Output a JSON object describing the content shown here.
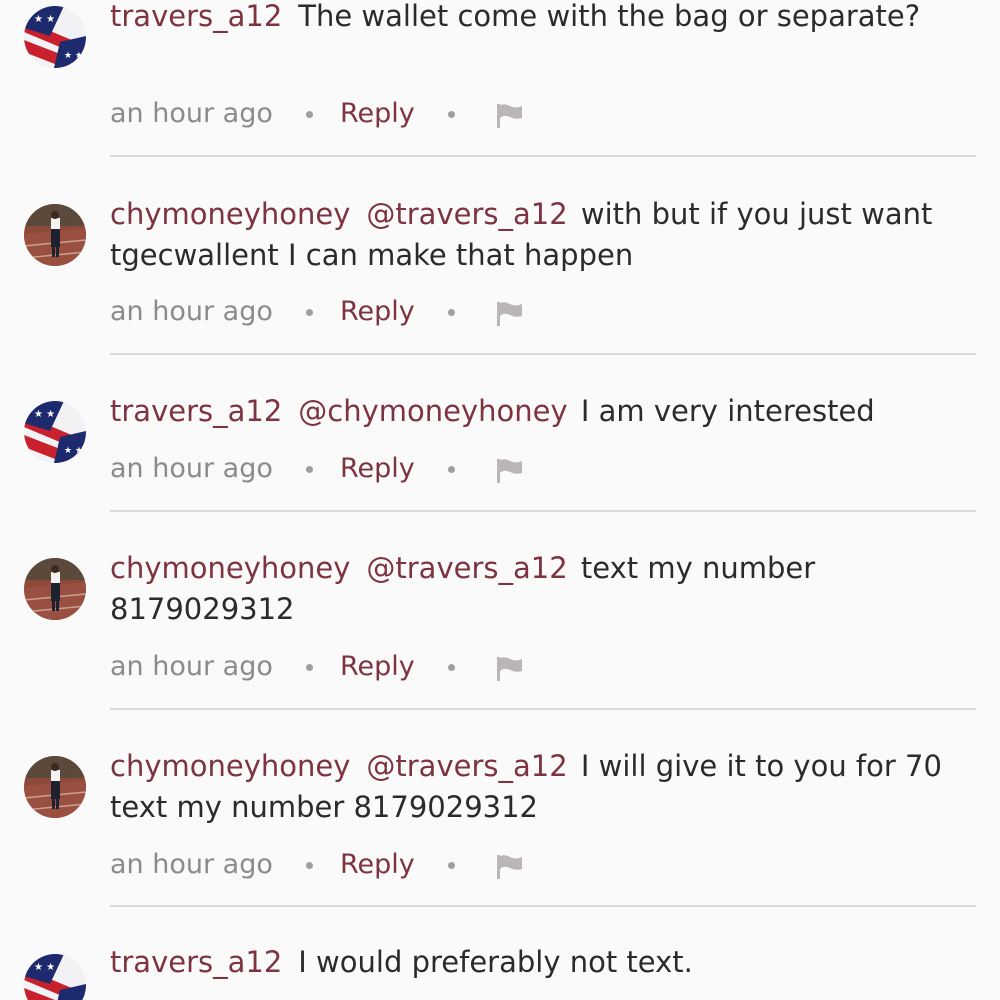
{
  "comments": [
    {
      "username": "travers_a12",
      "avatar_icon": "flag-avatar-icon",
      "mention": "",
      "text": "The wallet come with the bag or separate?",
      "time": "an hour ago",
      "reply_label": "Reply"
    },
    {
      "username": "chymoneyhoney",
      "avatar_icon": "photo-avatar-icon",
      "mention": "@travers_a12",
      "text": "with but if you just want tgecwallent I can make that happen",
      "time": "an hour ago",
      "reply_label": "Reply"
    },
    {
      "username": "travers_a12",
      "avatar_icon": "flag-avatar-icon",
      "mention": "@chymoneyhoney",
      "text": "I am very interested",
      "time": "an hour ago",
      "reply_label": "Reply"
    },
    {
      "username": "chymoneyhoney",
      "avatar_icon": "photo-avatar-icon",
      "mention": "@travers_a12",
      "text": "text my number 8179029312",
      "time": "an hour ago",
      "reply_label": "Reply"
    },
    {
      "username": "chymoneyhoney",
      "avatar_icon": "photo-avatar-icon",
      "mention": "@travers_a12",
      "text": "I will give it to you for 70 text my number 8179029312",
      "time": "an hour ago",
      "reply_label": "Reply"
    },
    {
      "username": "travers_a12",
      "avatar_icon": "flag-avatar-icon",
      "mention": "",
      "text": "I would preferably not text.",
      "time": "",
      "reply_label": ""
    }
  ],
  "colors": {
    "username": "#7e3440",
    "text": "#2d2a2b",
    "meta": "#8e8a8c",
    "background": "#fbfafb"
  }
}
